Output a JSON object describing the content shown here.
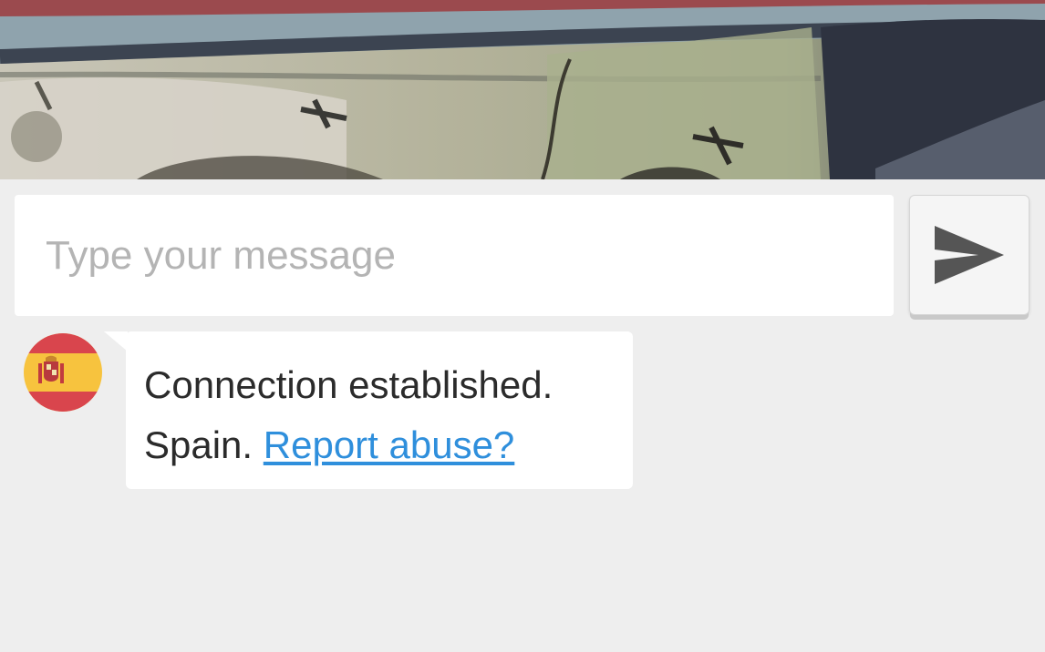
{
  "video": {
    "icon": "video-feed"
  },
  "composer": {
    "placeholder": "Type your message",
    "value": "",
    "send_icon": "send-icon"
  },
  "messages": [
    {
      "type": "system",
      "avatar_icon": "spain-flag-icon",
      "line1": "Connection established.",
      "country": "Spain.",
      "report_link": "Report abuse?"
    }
  ],
  "colors": {
    "background": "#eeeeee",
    "link": "#2f8fdc",
    "flag_red": "#d9454d",
    "flag_yellow": "#f7c33e",
    "send_arrow": "#555555"
  }
}
